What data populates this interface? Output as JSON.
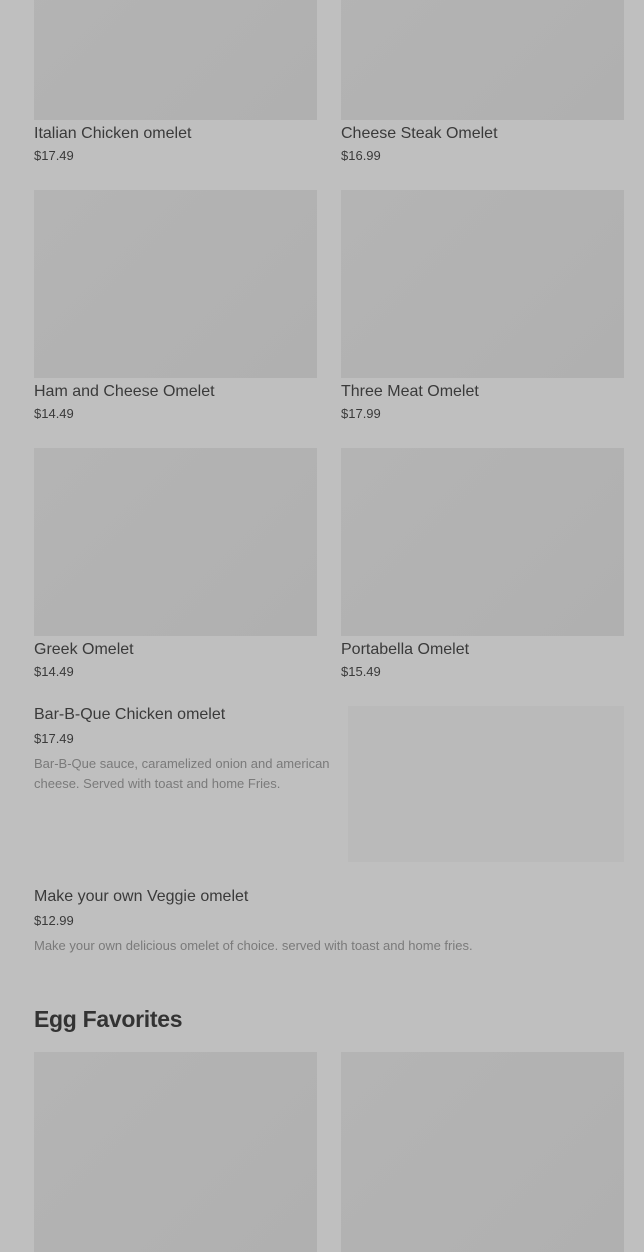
{
  "grid_items": [
    {
      "name": "Italian Chicken omelet",
      "price": "$17.49"
    },
    {
      "name": "Cheese Steak Omelet",
      "price": "$16.99"
    },
    {
      "name": "Ham and Cheese Omelet",
      "price": "$14.49"
    },
    {
      "name": "Three Meat Omelet",
      "price": "$17.99"
    },
    {
      "name": "Greek Omelet",
      "price": "$14.49"
    },
    {
      "name": "Portabella Omelet",
      "price": "$15.49"
    }
  ],
  "list_items": [
    {
      "name": "Bar-B-Que Chicken omelet",
      "price": "$17.49",
      "description": "Bar-B-Que sauce, caramelized onion and american cheese. Served with toast and home Fries."
    },
    {
      "name": "Make your own Veggie omelet",
      "price": "$12.99",
      "description": "Make your own delicious omelet of choice. served with toast and home fries."
    }
  ],
  "section": {
    "title": "Egg Favorites"
  }
}
